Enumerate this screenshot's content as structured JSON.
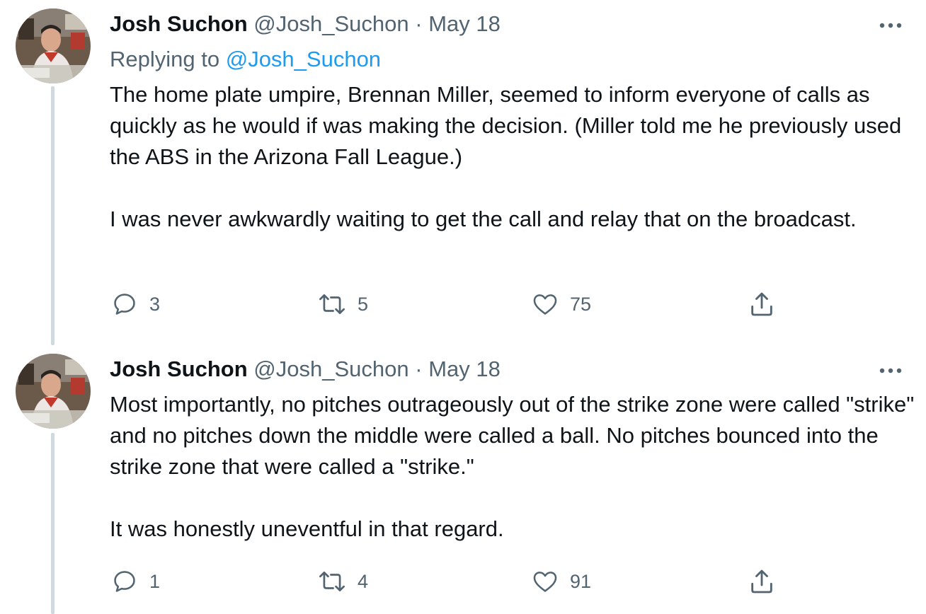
{
  "tweets": [
    {
      "author": {
        "name": "Josh Suchon",
        "handle": "@Josh_Suchon"
      },
      "separator": "·",
      "date": "May 18",
      "replying_to_label": "Replying to",
      "replying_to_handle": "@Josh_Suchon",
      "paragraphs": [
        "The home plate umpire, Brennan Miller, seemed to inform everyone of calls as quickly as he would if was making the decision. (Miller told me he previously used the ABS in the Arizona Fall League.)",
        "I was never awkwardly waiting to get the call and relay that on the broadcast."
      ],
      "stats": {
        "replies": "3",
        "retweets": "5",
        "likes": "75"
      }
    },
    {
      "author": {
        "name": "Josh Suchon",
        "handle": "@Josh_Suchon"
      },
      "separator": "·",
      "date": "May 18",
      "paragraphs": [
        "Most importantly, no pitches outrageously out of the strike zone were called \"strike\" and no pitches down the middle were called a ball. No pitches bounced into the strike zone that were called a \"strike.\"",
        "It was honestly uneventful in that regard."
      ],
      "stats": {
        "replies": "1",
        "retweets": "4",
        "likes": "91"
      }
    }
  ],
  "icons": {
    "reply": "reply-icon",
    "retweet": "retweet-icon",
    "like": "heart-icon",
    "share": "share-icon",
    "more": "more-options-icon"
  },
  "colors": {
    "text_primary": "#0f1419",
    "text_secondary": "#536471",
    "link": "#1d9bf0",
    "thread_line": "#cfd9de"
  }
}
